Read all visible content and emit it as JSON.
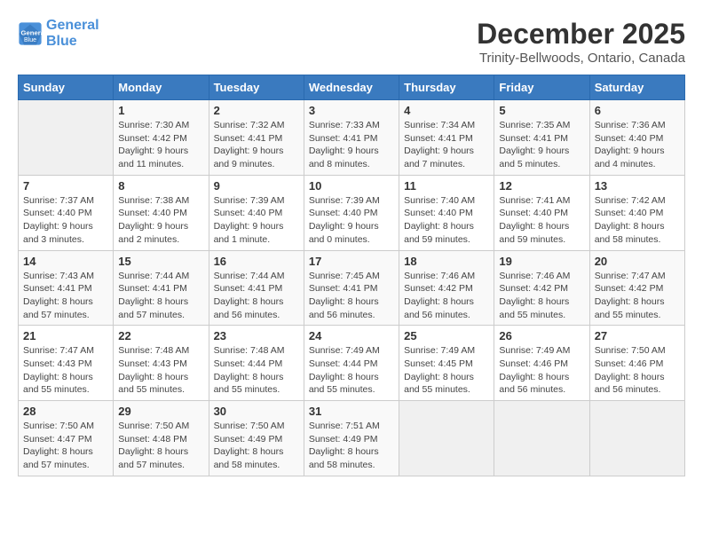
{
  "logo": {
    "line1": "General",
    "line2": "Blue"
  },
  "title": "December 2025",
  "subtitle": "Trinity-Bellwoods, Ontario, Canada",
  "days_of_week": [
    "Sunday",
    "Monday",
    "Tuesday",
    "Wednesday",
    "Thursday",
    "Friday",
    "Saturday"
  ],
  "weeks": [
    [
      {
        "day": "",
        "info": ""
      },
      {
        "day": "1",
        "info": "Sunrise: 7:30 AM\nSunset: 4:42 PM\nDaylight: 9 hours\nand 11 minutes."
      },
      {
        "day": "2",
        "info": "Sunrise: 7:32 AM\nSunset: 4:41 PM\nDaylight: 9 hours\nand 9 minutes."
      },
      {
        "day": "3",
        "info": "Sunrise: 7:33 AM\nSunset: 4:41 PM\nDaylight: 9 hours\nand 8 minutes."
      },
      {
        "day": "4",
        "info": "Sunrise: 7:34 AM\nSunset: 4:41 PM\nDaylight: 9 hours\nand 7 minutes."
      },
      {
        "day": "5",
        "info": "Sunrise: 7:35 AM\nSunset: 4:41 PM\nDaylight: 9 hours\nand 5 minutes."
      },
      {
        "day": "6",
        "info": "Sunrise: 7:36 AM\nSunset: 4:40 PM\nDaylight: 9 hours\nand 4 minutes."
      }
    ],
    [
      {
        "day": "7",
        "info": "Sunrise: 7:37 AM\nSunset: 4:40 PM\nDaylight: 9 hours\nand 3 minutes."
      },
      {
        "day": "8",
        "info": "Sunrise: 7:38 AM\nSunset: 4:40 PM\nDaylight: 9 hours\nand 2 minutes."
      },
      {
        "day": "9",
        "info": "Sunrise: 7:39 AM\nSunset: 4:40 PM\nDaylight: 9 hours\nand 1 minute."
      },
      {
        "day": "10",
        "info": "Sunrise: 7:39 AM\nSunset: 4:40 PM\nDaylight: 9 hours\nand 0 minutes."
      },
      {
        "day": "11",
        "info": "Sunrise: 7:40 AM\nSunset: 4:40 PM\nDaylight: 8 hours\nand 59 minutes."
      },
      {
        "day": "12",
        "info": "Sunrise: 7:41 AM\nSunset: 4:40 PM\nDaylight: 8 hours\nand 59 minutes."
      },
      {
        "day": "13",
        "info": "Sunrise: 7:42 AM\nSunset: 4:40 PM\nDaylight: 8 hours\nand 58 minutes."
      }
    ],
    [
      {
        "day": "14",
        "info": "Sunrise: 7:43 AM\nSunset: 4:41 PM\nDaylight: 8 hours\nand 57 minutes."
      },
      {
        "day": "15",
        "info": "Sunrise: 7:44 AM\nSunset: 4:41 PM\nDaylight: 8 hours\nand 57 minutes."
      },
      {
        "day": "16",
        "info": "Sunrise: 7:44 AM\nSunset: 4:41 PM\nDaylight: 8 hours\nand 56 minutes."
      },
      {
        "day": "17",
        "info": "Sunrise: 7:45 AM\nSunset: 4:41 PM\nDaylight: 8 hours\nand 56 minutes."
      },
      {
        "day": "18",
        "info": "Sunrise: 7:46 AM\nSunset: 4:42 PM\nDaylight: 8 hours\nand 56 minutes."
      },
      {
        "day": "19",
        "info": "Sunrise: 7:46 AM\nSunset: 4:42 PM\nDaylight: 8 hours\nand 55 minutes."
      },
      {
        "day": "20",
        "info": "Sunrise: 7:47 AM\nSunset: 4:42 PM\nDaylight: 8 hours\nand 55 minutes."
      }
    ],
    [
      {
        "day": "21",
        "info": "Sunrise: 7:47 AM\nSunset: 4:43 PM\nDaylight: 8 hours\nand 55 minutes."
      },
      {
        "day": "22",
        "info": "Sunrise: 7:48 AM\nSunset: 4:43 PM\nDaylight: 8 hours\nand 55 minutes."
      },
      {
        "day": "23",
        "info": "Sunrise: 7:48 AM\nSunset: 4:44 PM\nDaylight: 8 hours\nand 55 minutes."
      },
      {
        "day": "24",
        "info": "Sunrise: 7:49 AM\nSunset: 4:44 PM\nDaylight: 8 hours\nand 55 minutes."
      },
      {
        "day": "25",
        "info": "Sunrise: 7:49 AM\nSunset: 4:45 PM\nDaylight: 8 hours\nand 55 minutes."
      },
      {
        "day": "26",
        "info": "Sunrise: 7:49 AM\nSunset: 4:46 PM\nDaylight: 8 hours\nand 56 minutes."
      },
      {
        "day": "27",
        "info": "Sunrise: 7:50 AM\nSunset: 4:46 PM\nDaylight: 8 hours\nand 56 minutes."
      }
    ],
    [
      {
        "day": "28",
        "info": "Sunrise: 7:50 AM\nSunset: 4:47 PM\nDaylight: 8 hours\nand 57 minutes."
      },
      {
        "day": "29",
        "info": "Sunrise: 7:50 AM\nSunset: 4:48 PM\nDaylight: 8 hours\nand 57 minutes."
      },
      {
        "day": "30",
        "info": "Sunrise: 7:50 AM\nSunset: 4:49 PM\nDaylight: 8 hours\nand 58 minutes."
      },
      {
        "day": "31",
        "info": "Sunrise: 7:51 AM\nSunset: 4:49 PM\nDaylight: 8 hours\nand 58 minutes."
      },
      {
        "day": "",
        "info": ""
      },
      {
        "day": "",
        "info": ""
      },
      {
        "day": "",
        "info": ""
      }
    ]
  ]
}
